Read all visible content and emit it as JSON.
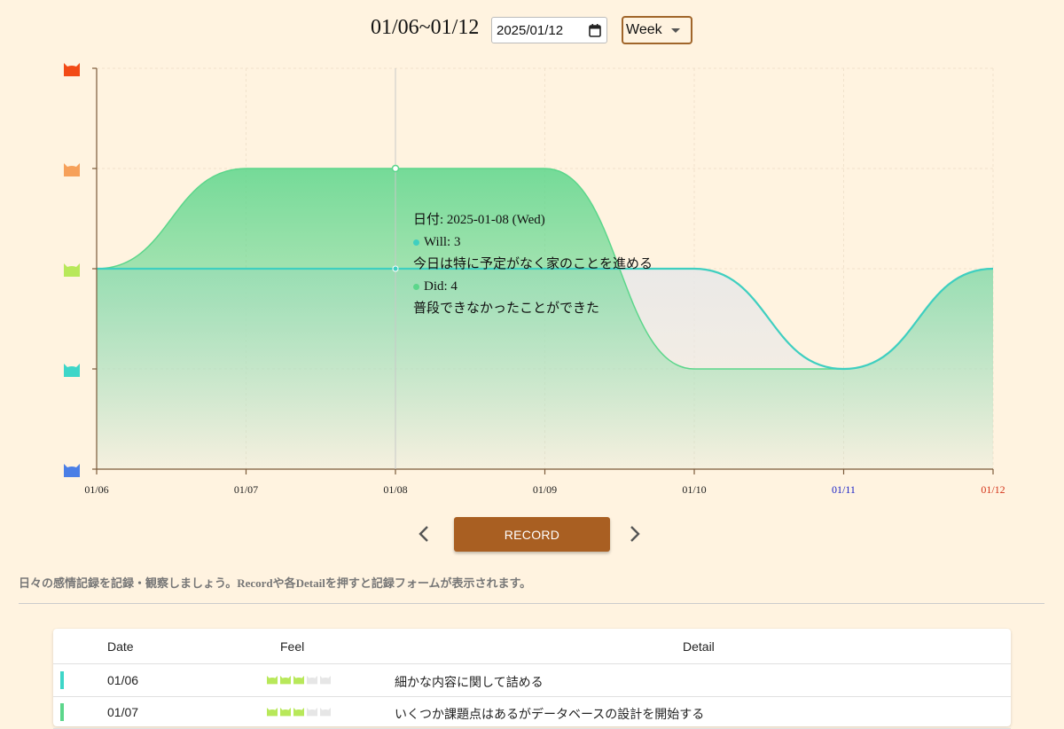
{
  "header": {
    "range_title": "01/06~01/12",
    "date_value": "2025/01/12",
    "period_selected": "Week"
  },
  "chart_data": {
    "type": "area",
    "categories": [
      "01/06",
      "01/07",
      "01/08",
      "01/09",
      "01/10",
      "01/11",
      "01/12"
    ],
    "category_colors": [
      "#222222",
      "#222222",
      "#222222",
      "#222222",
      "#222222",
      "#1a22c8",
      "#d4341a"
    ],
    "ylim": [
      0,
      4
    ],
    "y_level_icons": [
      "cat-blue-icon",
      "cat-teal-icon",
      "cat-lime-icon",
      "cat-peach-icon",
      "cat-red-icon"
    ],
    "y_level_colors": [
      "#4a7ee6",
      "#3ed6c8",
      "#b8e85a",
      "#f6a05a",
      "#f24a16"
    ],
    "series": [
      {
        "name": "Will",
        "color": "#3fcfc0",
        "values": [
          2,
          2,
          2,
          2,
          2,
          1,
          2
        ]
      },
      {
        "name": "Did",
        "color": "#5cd68b",
        "values": [
          2,
          3,
          3,
          3,
          1,
          1,
          2
        ]
      }
    ]
  },
  "tooltip": {
    "date_line": "日付: 2025-01-08 (Wed)",
    "will_line": "Will: 3",
    "will_note": "今日は特に予定がなく家のことを進める",
    "did_line": "Did: 4",
    "did_note": "普段できなかったことができた",
    "will_color": "#3fcfc0",
    "did_color": "#5cd68b"
  },
  "controls": {
    "record_label": "RECORD"
  },
  "help_text": "日々の感情記録を記録・観察しましょう。Recordや各Detailを押すと記録フォームが表示されます。",
  "table": {
    "headers": {
      "date": "Date",
      "feel": "Feel",
      "detail": "Detail"
    },
    "rows": [
      {
        "date": "01/06",
        "feel": 3,
        "feel_color": "#b8e85a",
        "bar_color": "#3ed6c8",
        "detail": "細かな内容に関して詰める"
      },
      {
        "date": "01/07",
        "feel": 3,
        "feel_color": "#b8e85a",
        "bar_color": "#5cd68b",
        "detail": "いくつか課題点はあるがデータベースの設計を開始する"
      }
    ]
  }
}
